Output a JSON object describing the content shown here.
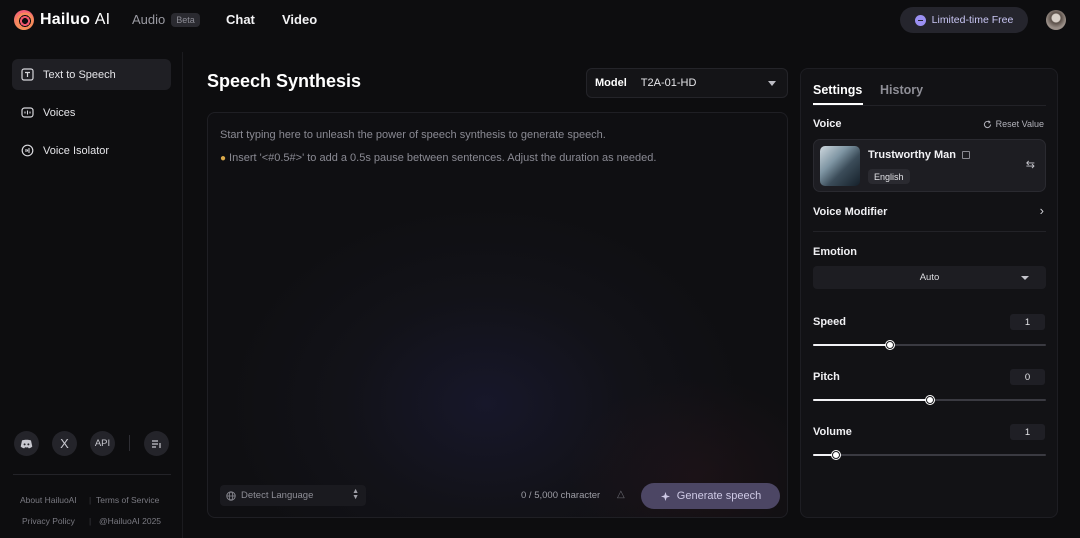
{
  "header": {
    "logo_text": "Hailuo",
    "logo_suffix": "AI",
    "nav": {
      "audio_label": "Audio",
      "audio_badge": "Beta",
      "chat_label": "Chat",
      "video_label": "Video"
    },
    "promo_label": "Limited-time Free"
  },
  "sidebar": {
    "items": [
      {
        "label": "Text to Speech",
        "icon": "text-to-speech-icon",
        "active": true
      },
      {
        "label": "Voices",
        "icon": "voices-icon",
        "active": false
      },
      {
        "label": "Voice Isolator",
        "icon": "voice-isolator-icon",
        "active": false
      }
    ],
    "social": {
      "discord": "discord-icon",
      "x": "X",
      "api": "API",
      "more": "menu-icon"
    },
    "footer": {
      "about": "About HailuoAI",
      "separator": "|",
      "terms": "Terms of Service",
      "privacy": "Privacy Policy",
      "copyright": "@HailuoAI 2025"
    }
  },
  "main": {
    "title": "Speech Synthesis",
    "model": {
      "label": "Model",
      "value": "T2A-01-HD"
    },
    "editor": {
      "placeholder_line1": "Start typing here to unleash the power of speech synthesis to generate speech.",
      "placeholder_line2": "Insert '<#0.5#>' to add a 0.5s pause between sentences. Adjust the duration as needed.",
      "language_select": "Detect Language",
      "char_count": "0 / 5,000 character",
      "generate_label": "Generate speech"
    }
  },
  "panel": {
    "tabs": {
      "settings": "Settings",
      "history": "History"
    },
    "voice_label": "Voice",
    "reset_label": "Reset Value",
    "voice": {
      "name": "Trustworthy Man",
      "language": "English"
    },
    "modifier_label": "Voice Modifier",
    "emotion_label": "Emotion",
    "emotion_value": "Auto",
    "speed": {
      "label": "Speed",
      "value": "1",
      "level": 0.33
    },
    "pitch": {
      "label": "Pitch",
      "value": "0",
      "level": 0.5
    },
    "volume": {
      "label": "Volume",
      "value": "1",
      "level": 0.1
    }
  },
  "colors": {
    "background": "#0d0d0f",
    "panel": "#121215",
    "accent_button": "#4c4664",
    "promo_text": "#c9c6f4"
  }
}
